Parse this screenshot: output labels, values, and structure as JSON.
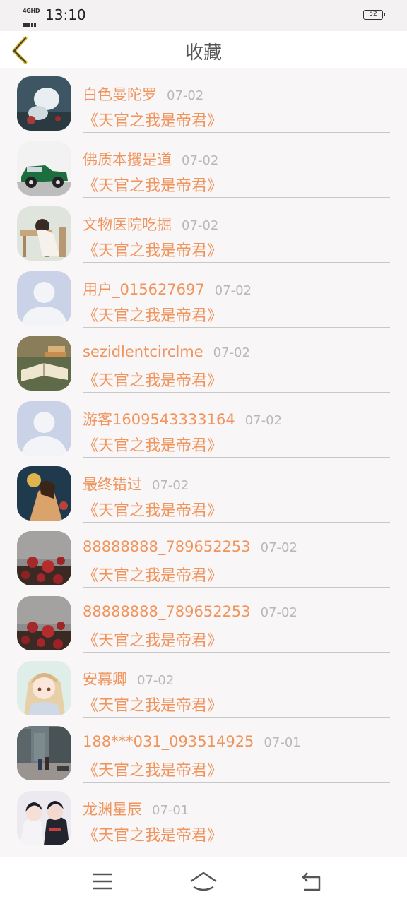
{
  "status_bar": {
    "network": "4GHD",
    "time": "13:10",
    "battery": "52"
  },
  "header": {
    "title": "收藏",
    "back_icon": "chevron-left-icon",
    "accent": "#d6b422"
  },
  "items": [
    {
      "user": "",
      "date": "",
      "book": "",
      "avatar": "partial",
      "hidden": true
    },
    {
      "user": "白色曼陀罗",
      "date": "07-02",
      "book": "《天官之我是帝君》",
      "avatar": "wolf"
    },
    {
      "user": "佛质本攫是道",
      "date": "07-02",
      "book": "《天官之我是帝君》",
      "avatar": "car"
    },
    {
      "user": "文物医院吃掘",
      "date": "07-02",
      "book": "《天官之我是帝君》",
      "avatar": "girl-desk"
    },
    {
      "user": "用户_015627697",
      "date": "07-02",
      "book": "《天官之我是帝君》",
      "avatar": "default"
    },
    {
      "user": "sezidlentcirclme",
      "date": "07-02",
      "book": "《天官之我是帝君》",
      "avatar": "book"
    },
    {
      "user": "游客1609543333164",
      "date": "07-02",
      "book": "《天官之我是帝君》",
      "avatar": "default"
    },
    {
      "user": "最终错过",
      "date": "07-02",
      "book": "《天官之我是帝君》",
      "avatar": "anime-dark"
    },
    {
      "user": "88888888_789652253",
      "date": "07-02",
      "book": "《天官之我是帝君》",
      "avatar": "roses"
    },
    {
      "user": "88888888_789652253",
      "date": "07-02",
      "book": "《天官之我是帝君》",
      "avatar": "roses"
    },
    {
      "user": "安幕卿",
      "date": "07-02",
      "book": "《天官之我是帝君》",
      "avatar": "anime-girl"
    },
    {
      "user": "188***031_093514925",
      "date": "07-01",
      "book": "《天官之我是帝君》",
      "avatar": "street"
    },
    {
      "user": "龙渊星辰",
      "date": "07-01",
      "book": "《天官之我是帝君》",
      "avatar": "anime-boys"
    }
  ],
  "colors": {
    "username": "#f0945c",
    "book": "#f0945c",
    "date": "#b8b8b8"
  },
  "nav_bar": {
    "icons": [
      "menu-icon",
      "home-icon",
      "back-icon"
    ]
  }
}
